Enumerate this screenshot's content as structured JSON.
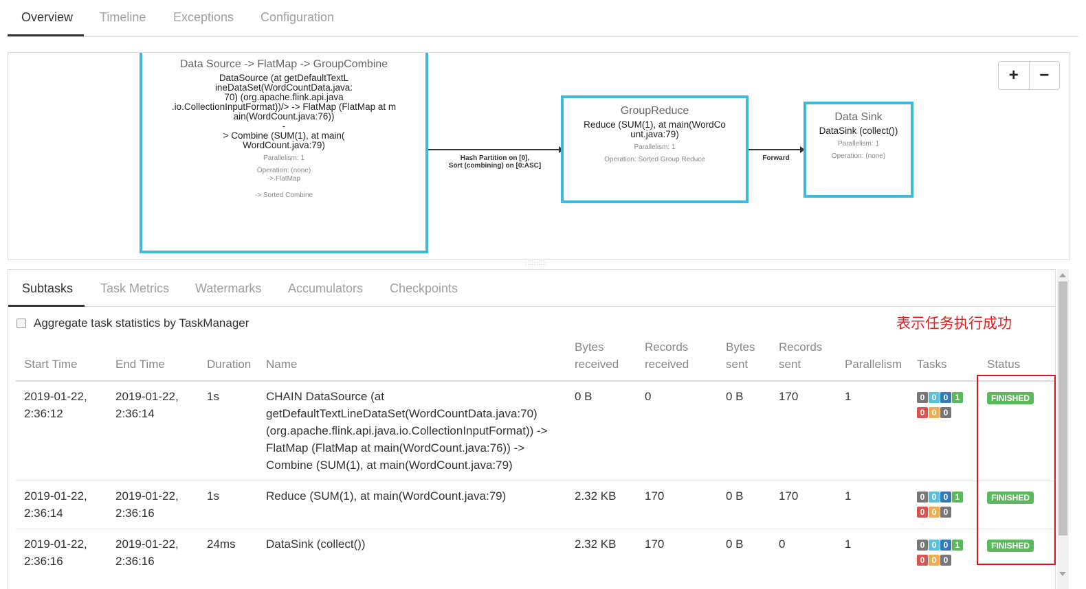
{
  "top_tabs": [
    "Overview",
    "Timeline",
    "Exceptions",
    "Configuration"
  ],
  "plan": {
    "nodes": [
      {
        "title": "Data Source -> FlatMap -> GroupCombine",
        "desc": "DataSource (at getDefaultTextL\nineDataSet(WordCountData.java:\n70) (org.apache.flink.api.java\n.io.CollectionInputFormat))/> -> FlatMap (FlatMap at m\nain(WordCount.java:76))\n-\n> Combine (SUM(1), at main(\nWordCount.java:79)",
        "parallelism": "Parallelism: 1",
        "operation": "Operation: (none)\n-> FlatMap\n\n-> Sorted Combine"
      },
      {
        "title": "GroupReduce",
        "desc": "Reduce (SUM(1), at main(WordCo\nunt.java:79)",
        "parallelism": "Parallelism: 1",
        "operation": "Operation: Sorted Group Reduce"
      },
      {
        "title": "Data Sink",
        "desc": "DataSink (collect())",
        "parallelism": "Parallelism: 1",
        "operation": "Operation: (none)"
      }
    ],
    "edges": [
      "Hash Partition on [0],\nSort (combining) on [0:ASC]",
      "Forward"
    ],
    "zoom_in": "+",
    "zoom_out": "−"
  },
  "sub_tabs": [
    "Subtasks",
    "Task Metrics",
    "Watermarks",
    "Accumulators",
    "Checkpoints"
  ],
  "aggregate_label": "Aggregate task statistics by TaskManager",
  "annotation": "表示任务执行成功",
  "columns": [
    "Start Time",
    "End Time",
    "Duration",
    "Name",
    "Bytes\nreceived",
    "Records\nreceived",
    "Bytes\nsent",
    "Records\nsent",
    "Parallelism",
    "Tasks",
    "Status"
  ],
  "rows": [
    {
      "start": "2019-01-22,\n2:36:12",
      "end": "2019-01-22,\n2:36:14",
      "duration": "1s",
      "name": "CHAIN DataSource (at\ngetDefaultTextLineDataSet(WordCountData.java:70)\n(org.apache.flink.api.java.io.CollectionInputFormat)) ->\nFlatMap (FlatMap at main(WordCount.java:76)) ->\nCombine (SUM(1), at main(WordCount.java:79)",
      "bytes_received": "0 B",
      "records_received": "0",
      "bytes_sent": "0 B",
      "records_sent": "170",
      "parallelism": "1",
      "tasks": [
        "0",
        "0",
        "0",
        "1",
        "0",
        "0",
        "0"
      ],
      "status": "FINISHED"
    },
    {
      "start": "2019-01-22,\n2:36:14",
      "end": "2019-01-22,\n2:36:16",
      "duration": "1s",
      "name": "Reduce (SUM(1), at main(WordCount.java:79)",
      "bytes_received": "2.32 KB",
      "records_received": "170",
      "bytes_sent": "0 B",
      "records_sent": "170",
      "parallelism": "1",
      "tasks": [
        "0",
        "0",
        "0",
        "1",
        "0",
        "0",
        "0"
      ],
      "status": "FINISHED"
    },
    {
      "start": "2019-01-22,\n2:36:16",
      "end": "2019-01-22,\n2:36:16",
      "duration": "24ms",
      "name": "DataSink (collect())",
      "bytes_received": "2.32 KB",
      "records_received": "170",
      "bytes_sent": "0 B",
      "records_sent": "0",
      "parallelism": "1",
      "tasks": [
        "0",
        "0",
        "0",
        "1",
        "0",
        "0",
        "0"
      ],
      "status": "FINISHED"
    }
  ],
  "task_colors": [
    "#777777",
    "#5bc0de",
    "#337ab7",
    "#5cb85c",
    "#d9534f",
    "#f0ad4e",
    "#777777"
  ],
  "status_color": "#5cb85c",
  "annotation_color": "#e02020"
}
